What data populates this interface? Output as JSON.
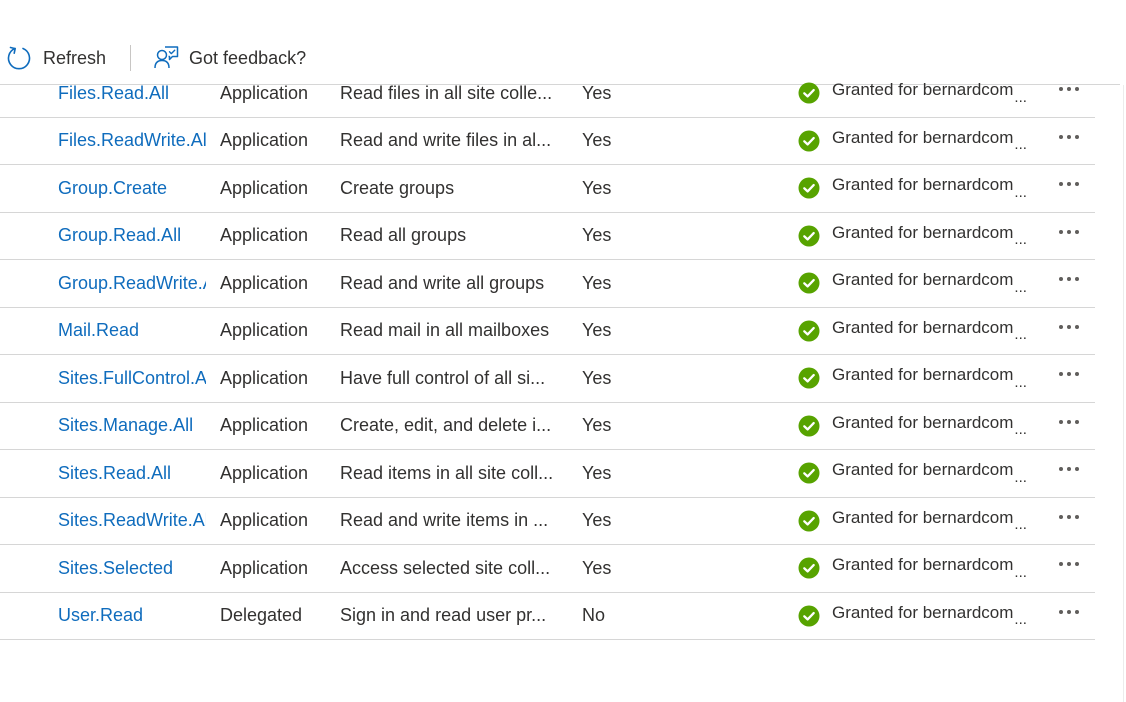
{
  "toolbar": {
    "refresh_label": "Refresh",
    "feedback_label": "Got feedback?"
  },
  "colors": {
    "link": "#0f6cbd",
    "granted_icon": "#57a300",
    "text": "#323130"
  },
  "permissions": [
    {
      "name": "Files.Read.All",
      "type": "Application",
      "description": "Read files in all site colle...",
      "admin_consent_required": "Yes",
      "status": "Granted for bernardcom",
      "status_icon": "check-circle-icon"
    },
    {
      "name": "Files.ReadWrite.All",
      "type": "Application",
      "description": "Read and write files in al...",
      "admin_consent_required": "Yes",
      "status": "Granted for bernardcom",
      "status_icon": "check-circle-icon"
    },
    {
      "name": "Group.Create",
      "type": "Application",
      "description": "Create groups",
      "admin_consent_required": "Yes",
      "status": "Granted for bernardcom",
      "status_icon": "check-circle-icon"
    },
    {
      "name": "Group.Read.All",
      "type": "Application",
      "description": "Read all groups",
      "admin_consent_required": "Yes",
      "status": "Granted for bernardcom",
      "status_icon": "check-circle-icon"
    },
    {
      "name": "Group.ReadWrite.All",
      "type": "Application",
      "description": "Read and write all groups",
      "admin_consent_required": "Yes",
      "status": "Granted for bernardcom",
      "status_icon": "check-circle-icon"
    },
    {
      "name": "Mail.Read",
      "type": "Application",
      "description": "Read mail in all mailboxes",
      "admin_consent_required": "Yes",
      "status": "Granted for bernardcom",
      "status_icon": "check-circle-icon"
    },
    {
      "name": "Sites.FullControl.All",
      "type": "Application",
      "description": "Have full control of all si...",
      "admin_consent_required": "Yes",
      "status": "Granted for bernardcom",
      "status_icon": "check-circle-icon"
    },
    {
      "name": "Sites.Manage.All",
      "type": "Application",
      "description": "Create, edit, and delete i...",
      "admin_consent_required": "Yes",
      "status": "Granted for bernardcom",
      "status_icon": "check-circle-icon"
    },
    {
      "name": "Sites.Read.All",
      "type": "Application",
      "description": "Read items in all site coll...",
      "admin_consent_required": "Yes",
      "status": "Granted for bernardcom",
      "status_icon": "check-circle-icon"
    },
    {
      "name": "Sites.ReadWrite.All",
      "type": "Application",
      "description": "Read and write items in ...",
      "admin_consent_required": "Yes",
      "status": "Granted for bernardcom",
      "status_icon": "check-circle-icon"
    },
    {
      "name": "Sites.Selected",
      "type": "Application",
      "description": "Access selected site coll...",
      "admin_consent_required": "Yes",
      "status": "Granted for bernardcom",
      "status_icon": "check-circle-icon"
    },
    {
      "name": "User.Read",
      "type": "Delegated",
      "description": "Sign in and read user pr...",
      "admin_consent_required": "No",
      "status": "Granted for bernardcom",
      "status_icon": "check-circle-icon"
    }
  ],
  "status_truncation": "..."
}
